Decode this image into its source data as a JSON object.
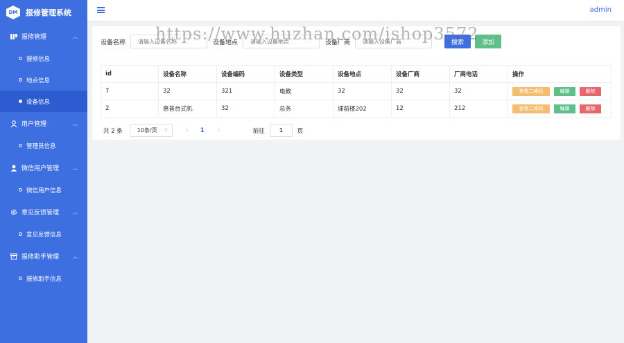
{
  "app": {
    "logo_text": "DM",
    "title": "报修管理系统"
  },
  "sidebar": {
    "groups": [
      {
        "label": "报修管理",
        "icon": "board-icon",
        "items": [
          {
            "label": "报修信息",
            "active": false
          },
          {
            "label": "地点信息",
            "active": false
          },
          {
            "label": "设备信息",
            "active": true
          }
        ]
      },
      {
        "label": "用户管理",
        "icon": "user-icon",
        "items": [
          {
            "label": "管理员信息",
            "active": false
          }
        ]
      },
      {
        "label": "微信用户管理",
        "icon": "person-icon",
        "items": [
          {
            "label": "微信用户信息",
            "active": false
          }
        ]
      },
      {
        "label": "意见反馈管理",
        "icon": "gear-icon",
        "items": [
          {
            "label": "意见反馈信息",
            "active": false
          }
        ]
      },
      {
        "label": "报修助手管理",
        "icon": "box-icon",
        "items": [
          {
            "label": "报修助手信息",
            "active": false
          }
        ]
      }
    ]
  },
  "header": {
    "user": "admin"
  },
  "filters": {
    "name_label": "设备名称",
    "name_placeholder": "请输入设备名称",
    "location_label": "设备地点",
    "location_placeholder": "请输入设备地点",
    "vendor_label": "设备厂商",
    "vendor_placeholder": "请输入设备厂商",
    "search_label": "搜索",
    "add_label": "添加"
  },
  "table": {
    "columns": [
      "id",
      "设备名称",
      "设备编码",
      "设备类型",
      "设备地点",
      "设备厂商",
      "厂商电话",
      "操作"
    ],
    "rows": [
      {
        "id": "7",
        "name": "32",
        "code": "321",
        "type": "电教",
        "location": "32",
        "vendor": "32",
        "phone": "32"
      },
      {
        "id": "2",
        "name": "惠普台式机",
        "code": "32",
        "type": "总务",
        "location": "课前楼202",
        "vendor": "12",
        "phone": "212"
      }
    ],
    "actions": {
      "qr": "查看二维码",
      "edit": "编辑",
      "delete": "删除"
    }
  },
  "pagination": {
    "total_text": "共 2 条",
    "page_size": "10条/页",
    "prev": "‹",
    "current": "1",
    "next": "›",
    "goto_label": "前往",
    "goto_value": "1",
    "page_unit": "页"
  },
  "watermark": "https://www.huzhan.com/ishop3572",
  "colors": {
    "primary": "#3d6fe0",
    "success": "#5fbf8a",
    "warning": "#f3be6f",
    "danger": "#e8676b"
  }
}
